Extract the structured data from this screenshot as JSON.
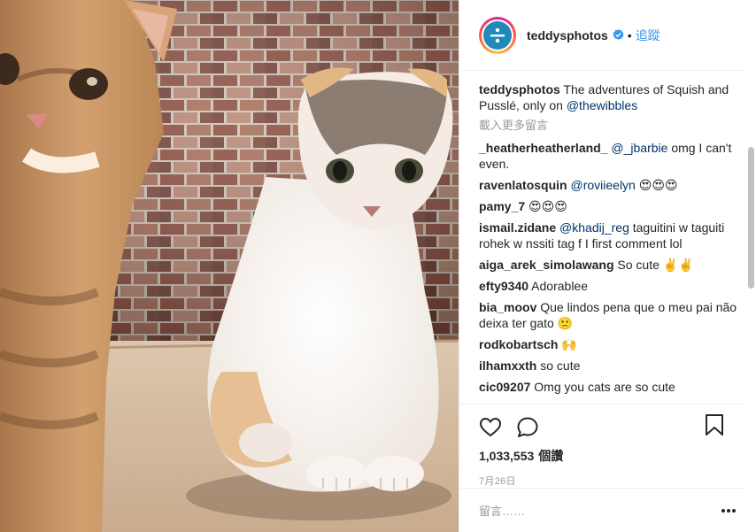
{
  "post": {
    "username": "teddysphotos",
    "follow_label": "追蹤",
    "dot": "•",
    "caption_user": "teddysphotos",
    "caption_text": "The adventures of Squish and Pusslé, only on",
    "caption_mention": "@thewibbles",
    "load_more": "載入更多留言",
    "views_count": "1,033,553",
    "views_unit": "個讚",
    "date": "7月26日",
    "add_comment_placeholder": "留言……"
  },
  "comments": [
    {
      "user": "_heatherheatherland_",
      "mention": "@_jbarbie",
      "text": "omg I can't even."
    },
    {
      "user": "ravenlatosquin",
      "mention": "@roviieelyn",
      "text": "😍😍😍"
    },
    {
      "user": "pamy_7",
      "mention": "",
      "text": "😍😍😍"
    },
    {
      "user": "ismail.zidane",
      "mention": "@khadij_reg",
      "text": "taguitini w taguiti rohek w nssiti tag f I first comment lol"
    },
    {
      "user": "aiga_arek_simolawang",
      "mention": "",
      "text": "So cute ✌️✌️"
    },
    {
      "user": "efty9340",
      "mention": "",
      "text": "Adorablee"
    },
    {
      "user": "bia_moov",
      "mention": "",
      "text": "Que lindos pena que o meu pai não deixa ter gato 🙁"
    },
    {
      "user": "rodkobartsch",
      "mention": "",
      "text": "🙌"
    },
    {
      "user": "ilhamxxth",
      "mention": "",
      "text": "so cute"
    },
    {
      "user": "cic09207",
      "mention": "",
      "text": "Omg you cats are so cute"
    }
  ],
  "icons": {
    "verified": "verified-badge-icon",
    "like": "heart-icon",
    "comment": "comment-bubble-icon",
    "save": "bookmark-icon",
    "more": "more-options-icon"
  },
  "colors": {
    "link_blue": "#3897f0",
    "mention_navy": "#003569",
    "muted": "#999999",
    "avatar_blue": "#1f8ab8"
  }
}
